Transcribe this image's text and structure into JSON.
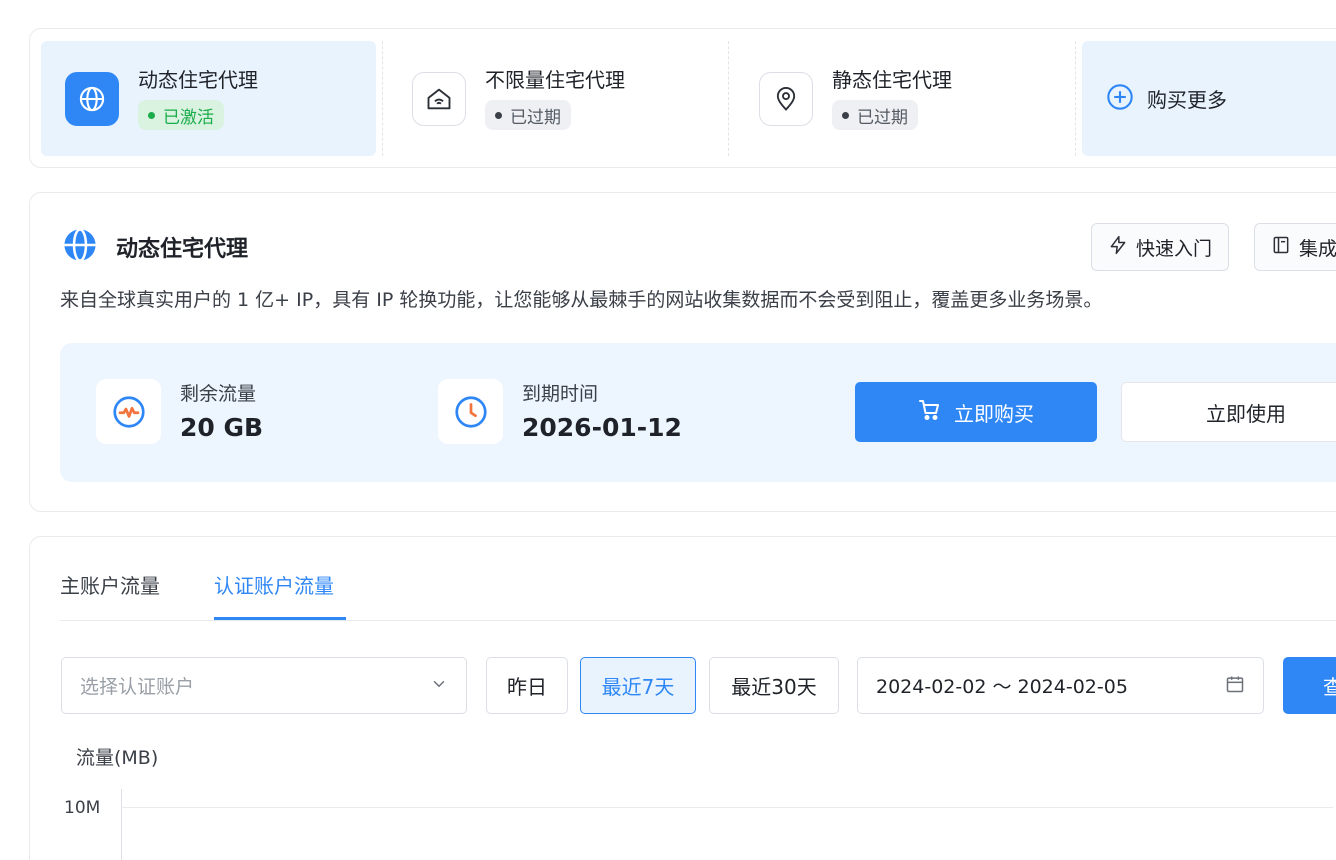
{
  "products": {
    "items": [
      {
        "title": "动态住宅代理",
        "status": "已激活",
        "icon": "globe-icon"
      },
      {
        "title": "不限量住宅代理",
        "status": "已过期",
        "icon": "home-wifi-icon"
      },
      {
        "title": "静态住宅代理",
        "status": "已过期",
        "icon": "location-pin-icon"
      }
    ],
    "buy_more_label": "购买更多"
  },
  "detail": {
    "title": "动态住宅代理",
    "quick_start_label": "快速入门",
    "integration_label": "集成",
    "description": "来自全球真实用户的 1 亿+ IP，具有 IP 轮换功能，让您能够从最棘手的网站收集数据而不会受到阻止，覆盖更多业务场景。",
    "remaining_traffic_label": "剩余流量",
    "remaining_traffic_value": "20 GB",
    "expiry_label": "到期时间",
    "expiry_value": "2026-01-12",
    "buy_now_label": "立即购买",
    "use_now_label": "立即使用"
  },
  "traffic": {
    "tabs": [
      {
        "label": "主账户流量",
        "active": false
      },
      {
        "label": "认证账户流量",
        "active": true
      }
    ],
    "account_select_placeholder": "选择认证账户",
    "range_chips": [
      {
        "label": "昨日",
        "active": false
      },
      {
        "label": "最近7天",
        "active": true
      },
      {
        "label": "最近30天",
        "active": false
      }
    ],
    "date_range": "2024-02-02 ～ 2024-02-05",
    "query_label": "查",
    "chart": {
      "ylabel": "流量(MB)",
      "tick_top": "10M"
    }
  },
  "colors": {
    "accent": "#2f87f6",
    "active_status": "#1aab4a",
    "panel_bg": "#edf5fe"
  }
}
